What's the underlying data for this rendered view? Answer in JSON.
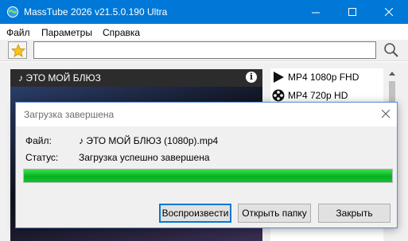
{
  "window": {
    "title": "MassTube 2026 v21.5.0.190 Ultra",
    "app_icon": "globe-icon",
    "controls": [
      "minimize-icon",
      "maximize-icon",
      "close-icon"
    ],
    "accent_color": "#0078d7"
  },
  "menu": {
    "items": [
      {
        "label": "Файл"
      },
      {
        "label": "Параметры"
      },
      {
        "label": "Справка"
      }
    ]
  },
  "toolbar": {
    "favorite_icon": "star-icon",
    "url_value": "",
    "url_placeholder": "",
    "search_icon": "search-icon"
  },
  "video": {
    "title": "♪ ЭТО МОЙ БЛЮЗ",
    "info_icon": "info-icon",
    "info_glyph": "i"
  },
  "formats": {
    "items": [
      {
        "label": "MP4 1080p FHD",
        "icon": "play-icon"
      },
      {
        "label": "MP4 720p HD",
        "icon": "film-reel-icon"
      }
    ]
  },
  "dialog": {
    "title": "Загрузка завершена",
    "file_label": "Файл:",
    "file_value": "♪ ЭТО МОЙ БЛЮЗ (1080p).mp4",
    "status_label": "Статус:",
    "status_value": "Загрузка успешно завершена",
    "progress_percent": 100,
    "progress_color": "#06b025",
    "buttons": {
      "play": "Воспроизвести",
      "open_folder": "Открыть папку",
      "close": "Закрыть"
    }
  }
}
